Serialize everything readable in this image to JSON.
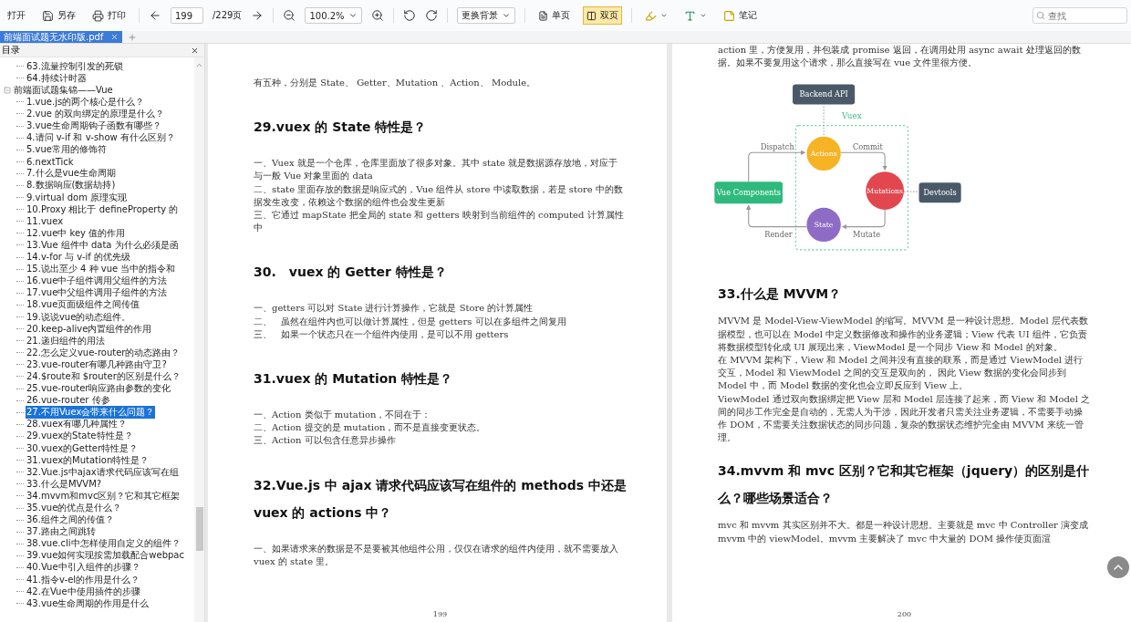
{
  "toolbar": {
    "open": "打开",
    "save_as": "另存",
    "print": "打印",
    "page": "199",
    "page_total": "/229页",
    "zoom": "100.2%",
    "background": "更换背景",
    "view_modes": [
      {
        "label": "单页",
        "selected": false
      },
      {
        "label": "双页",
        "selected": true
      }
    ],
    "note": "笔记"
  },
  "search": {
    "placeholder": "查找"
  },
  "tabs": [
    {
      "label": "前端面试题无水印版.pdf",
      "selected": true
    }
  ],
  "sidebar": {
    "title": "目录",
    "continued_items": [
      {
        "label": "63.流量控制引发的死锁",
        "selected": false
      },
      {
        "label": "64.持续计时器",
        "selected": false
      }
    ],
    "sections": [
      {
        "label": "前端面试题集锦——Vue",
        "expanded": true,
        "children": [
          {
            "label": "1.vue.js的两个核心是什么？",
            "selected": false
          },
          {
            "label": "2.vue 的双向绑定的原理是什么？",
            "selected": false
          },
          {
            "label": "3.vue生命周期钩子函数有哪些？",
            "selected": false
          },
          {
            "label": "4.请问 v-if 和 v-show 有什么区别？",
            "selected": false
          },
          {
            "label": "5.vue常用的修饰符",
            "selected": false
          },
          {
            "label": "6.nextTick",
            "selected": false
          },
          {
            "label": "7.什么是vue生命周期",
            "selected": false
          },
          {
            "label": "8.数据响应(数据劫持)",
            "selected": false
          },
          {
            "label": "9.virtual dom 原理实现",
            "selected": false
          },
          {
            "label": "10.Proxy 相比于 defineProperty 的",
            "selected": false
          },
          {
            "label": "11.vuex",
            "selected": false
          },
          {
            "label": "12.vue中 key 值的作用",
            "selected": false
          },
          {
            "label": "13.Vue 组件中 data 为什么必须是函",
            "selected": false
          },
          {
            "label": "14.v-for 与 v-if 的优先级",
            "selected": false
          },
          {
            "label": "15.说出至少 4 种 vue 当中的指令和",
            "selected": false
          },
          {
            "label": "16.vue中子组件调用父组件的方法",
            "selected": false
          },
          {
            "label": "17.vue中父组件调用子组件的方法",
            "selected": false
          },
          {
            "label": "18.vue页面级组件之间传值",
            "selected": false
          },
          {
            "label": "19.说说vue的动态组件。",
            "selected": false
          },
          {
            "label": "20.keep-alive内置组件的作用",
            "selected": false
          },
          {
            "label": "21.递归组件的用法",
            "selected": false
          },
          {
            "label": "22.怎么定义vue-router的动态路由？",
            "selected": false
          },
          {
            "label": "23.vue-router有哪几种路由守卫?",
            "selected": false
          },
          {
            "label": "24.$route和 $router的区别是什么？",
            "selected": false
          },
          {
            "label": "25.vue-router响应路由参数的变化",
            "selected": false
          },
          {
            "label": "26.vue-router 传参",
            "selected": false
          },
          {
            "label": "27.不用Vuex会带来什么问题？",
            "selected": true
          },
          {
            "label": "28.vuex有哪几种属性？",
            "selected": false
          },
          {
            "label": "29.vuex的State特性是？",
            "selected": false
          },
          {
            "label": "30.vuex的Getter特性是？",
            "selected": false
          },
          {
            "label": "31.vuex的Mutation特性是？",
            "selected": false
          },
          {
            "label": "32.Vue.js中ajax请求代码应该写在组",
            "selected": false
          },
          {
            "label": "33.什么是MVVM?",
            "selected": false
          },
          {
            "label": "34.mvvm和mvc区别？它和其它框架",
            "selected": false
          },
          {
            "label": "35.vue的优点是什么？",
            "selected": false
          },
          {
            "label": "36.组件之间的传值？",
            "selected": false
          },
          {
            "label": "37.路由之间跳转",
            "selected": false
          },
          {
            "label": "38.vue.cli中怎样使用自定义的组件？",
            "selected": false
          },
          {
            "label": "39.vue如何实现按需加载配合webpac",
            "selected": false
          },
          {
            "label": "40.Vue中引入组件的步骤？",
            "selected": false
          },
          {
            "label": "41.指令v-el的作用是什么？",
            "selected": false
          },
          {
            "label": "42.在Vue中使用插件的步骤",
            "selected": false
          },
          {
            "label": "43.vue生命周期的作用是什么",
            "selected": false
          }
        ]
      }
    ]
  },
  "pages": [
    {
      "number": "199",
      "blocks": [
        {
          "kind": "p",
          "text": "有五种，分别是 State、 Getter、Mutation 、Action、 Module。"
        },
        {
          "kind": "h",
          "text": "29.vuex 的 State 特性是？"
        },
        {
          "kind": "p",
          "text": "一、Vuex 就是一个仓库，仓库里面放了很多对象。其中 state 就是数据源存放地，对应于与一般 Vue 对象里面的 data"
        },
        {
          "kind": "p",
          "text": "二、state 里面存放的数据是响应式的，Vue 组件从 store 中读取数据，若是 store 中的数据发生改变，依赖这个数据的组件也会发生更新"
        },
        {
          "kind": "p",
          "text": "三、它通过 mapState 把全局的 state 和 getters 映射到当前组件的 computed 计算属性中"
        },
        {
          "kind": "h",
          "text": "30.　vuex 的 Getter 特性是？"
        },
        {
          "kind": "p",
          "text": "一、getters 可以对 State 进行计算操作，它就是 Store 的计算属性"
        },
        {
          "kind": "p",
          "text": "二、　虽然在组件内也可以做计算属性，但是 getters 可以在多组件之间复用"
        },
        {
          "kind": "p",
          "text": "三、　如果一个状态只在一个组件内使用，是可以不用 getters"
        },
        {
          "kind": "h",
          "text": "31.vuex 的 Mutation 特性是？"
        },
        {
          "kind": "p",
          "text": "一、Action 类似于 mutation，不同在于："
        },
        {
          "kind": "p",
          "text": "二、Action 提交的是 mutation，而不是直接变更状态。"
        },
        {
          "kind": "p",
          "text": "三、Action 可以包含任意异步操作"
        },
        {
          "kind": "h",
          "text": "32.Vue.js 中 ajax 请求代码应该写在组件的 methods 中还是 vuex 的 actions 中？"
        },
        {
          "kind": "p",
          "text": "一、如果请求来的数据是不是要被其他组件公用，仅仅在请求的组件内使用，就不需要放入 vuex 的 state 里。"
        }
      ]
    },
    {
      "number": "200",
      "blocks": [
        {
          "kind": "p",
          "text": "action 里，方便复用，并包装成 promise 返回，在调用处用 async await 处理返回的数据。如果不要复用这个请求，那么直接写在 vue 文件里很方便。"
        },
        {
          "kind": "diagram",
          "title": "Vuex",
          "nodes": [
            {
              "label": "Backend API"
            },
            {
              "label": "Actions"
            },
            {
              "label": "Mutations"
            },
            {
              "label": "State"
            },
            {
              "label": "Vue Components"
            },
            {
              "label": "Devtools"
            }
          ],
          "edges": [
            {
              "label": "Dispatch"
            },
            {
              "label": "Commit"
            },
            {
              "label": "Render"
            },
            {
              "label": "Mutate"
            }
          ]
        },
        {
          "kind": "h",
          "text": "33.什么是 MVVM？"
        },
        {
          "kind": "p",
          "text": "MVVM 是 Model-View-ViewModel 的缩写。MVVM 是一种设计思想。Model 层代表数据模型，也可以在 Model 中定义数据修改和操作的业务逻辑；View 代表 UI 组件，它负责将数据模型转化成 UI 展现出来，ViewModel 是一个同步 View 和 Model 的对象。"
        },
        {
          "kind": "p",
          "text": "在 MVVM 架构下，View 和 Model 之间并没有直接的联系，而是通过 ViewModel 进行交互，Model 和 ViewModel 之间的交互是双向的， 因此 View 数据的变化会同步到 Model 中，而 Model 数据的变化也会立即反应到 View 上。"
        },
        {
          "kind": "p",
          "text": "ViewModel 通过双向数据绑定把 View 层和 Model 层连接了起来，而 View 和 Model 之间的同步工作完全是自动的，无需人为干涉，因此开发者只需关注业务逻辑，不需要手动操作 DOM，不需要关注数据状态的同步问题，复杂的数据状态维护完全由 MVVM 来统一管理。"
        },
        {
          "kind": "h",
          "text": "34.mvvm 和 mvc 区别？它和其它框架（jquery）的区别是什么？哪些场景适合？"
        },
        {
          "kind": "p",
          "text": "mvc 和 mvvm 其实区别并不大。都是一种设计思想。主要就是 mvc 中 Controller 演变成 mvvm 中的 viewModel。mvvm 主要解决了 mvc 中大量的 DOM 操作使页面渲"
        }
      ]
    }
  ]
}
